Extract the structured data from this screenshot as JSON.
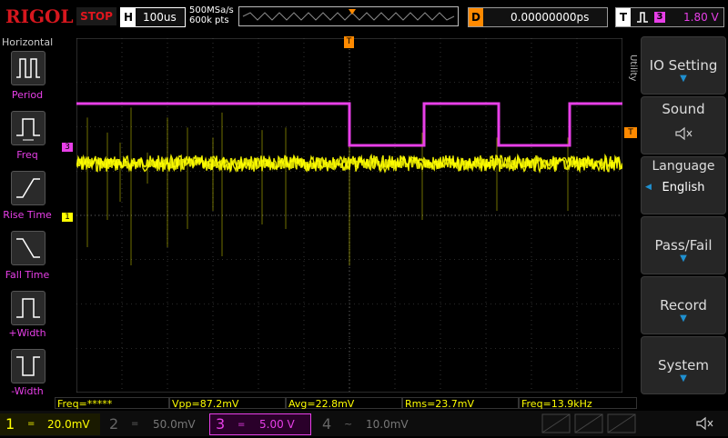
{
  "header": {
    "logo": "RIGOL",
    "run_state": "STOP",
    "horizontal": {
      "letter": "H",
      "timebase": "100us"
    },
    "sample_rate": "500MSa/s",
    "memory_depth": "600k pts",
    "delay": {
      "letter": "D",
      "value": "0.00000000ps"
    },
    "trigger": {
      "letter": "T",
      "channel": "3",
      "level": "1.80 V"
    }
  },
  "left_menu": {
    "title": "Horizontal",
    "items": [
      {
        "label": "Period",
        "icon": "period-icon"
      },
      {
        "label": "Freq",
        "icon": "freq-icon"
      },
      {
        "label": "Rise Time",
        "icon": "rise-time-icon"
      },
      {
        "label": "Fall Time",
        "icon": "fall-time-icon"
      },
      {
        "label": "+Width",
        "icon": "positive-width-icon"
      },
      {
        "label": "-Width",
        "icon": "negative-width-icon"
      }
    ]
  },
  "right_menu": {
    "title": "Utility",
    "items": [
      {
        "label": "IO Setting"
      },
      {
        "label": "Sound"
      },
      {
        "label": "Language",
        "value": "English"
      },
      {
        "label": "Pass/Fail"
      },
      {
        "label": "Record"
      },
      {
        "label": "System"
      }
    ]
  },
  "markers": {
    "ch3": "3",
    "ch1": "1",
    "trigger": "T"
  },
  "measurements": [
    {
      "text": "Freq=*****"
    },
    {
      "text": "Vpp=87.2mV"
    },
    {
      "text": "Avg=22.8mV"
    },
    {
      "text": "Rms=23.7mV"
    },
    {
      "text": "Freq=13.9kHz"
    }
  ],
  "channels": [
    {
      "num": "1",
      "coupling": "=",
      "scale": "20.0mV",
      "color": "#ffff00"
    },
    {
      "num": "2",
      "coupling": "=",
      "scale": "50.0mV",
      "color": "#00c8ff"
    },
    {
      "num": "3",
      "coupling": "=",
      "scale": "5.00 V",
      "color": "#e83fe8"
    },
    {
      "num": "4",
      "coupling": "~",
      "scale": "10.0mV",
      "color": "#3b7bff"
    }
  ],
  "colors": {
    "ch1": "#ffff00",
    "ch3": "#e83fe8",
    "trigger": "#ff8a00"
  }
}
